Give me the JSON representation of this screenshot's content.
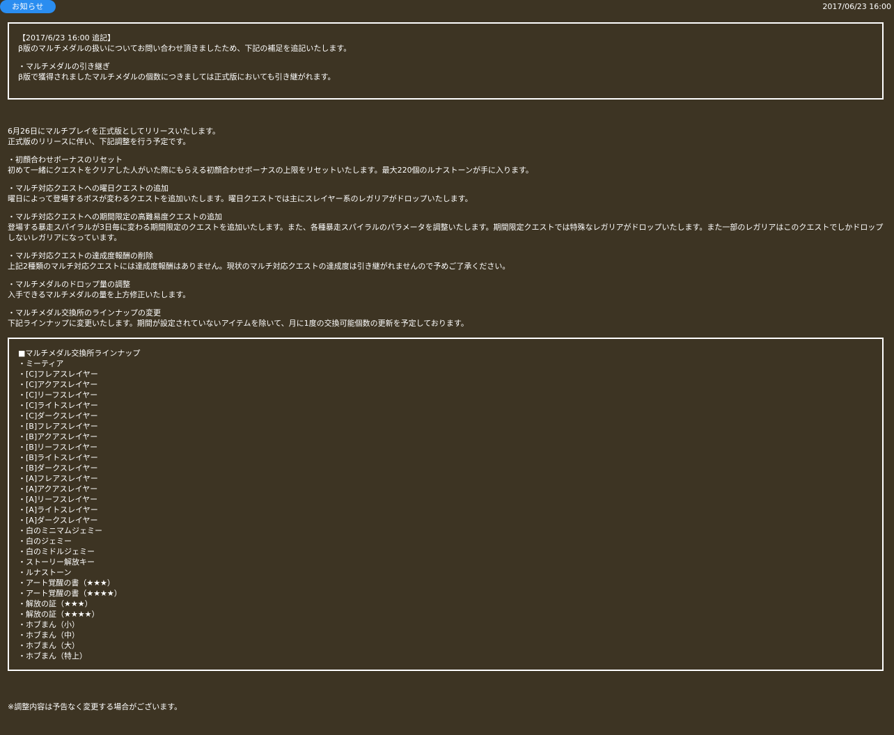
{
  "header": {
    "badge": "お知らせ",
    "date": "2017/06/23 16:00"
  },
  "addendum": {
    "title": "【2017/6/23 16:00 追記】",
    "line1": "β版のマルチメダルの扱いについてお問い合わせ頂きましたため、下記の補足を追記いたします。",
    "item_heading": "・マルチメダルの引き継ぎ",
    "item_body": "β版で獲得されましたマルチメダルの個数につきましては正式版においても引き継がれます。"
  },
  "intro": {
    "line1": "6月26日にマルチプレイを正式版としてリリースいたします。",
    "line2": "正式版のリリースに伴い、下記調整を行う予定です。"
  },
  "sections": [
    {
      "heading": "・初顔合わせボーナスのリセット",
      "body": "初めて一緒にクエストをクリアした人がいた際にもらえる初顔合わせボーナスの上限をリセットいたします。最大220個のルナストーンが手に入ります。"
    },
    {
      "heading": "・マルチ対応クエストへの曜日クエストの追加",
      "body": "曜日によって登場するボスが変わるクエストを追加いたします。曜日クエストでは主にスレイヤー系のレガリアがドロップいたします。"
    },
    {
      "heading": "・マルチ対応クエストへの期間限定の高難易度クエストの追加",
      "body": "登場する暴走スパイラルが3日毎に変わる期間限定のクエストを追加いたします。また、各種暴走スパイラルのパラメータを調整いたします。期間限定クエストでは特殊なレガリアがドロップいたします。また一部のレガリアはこのクエストでしかドロップしないレガリアになっています。"
    },
    {
      "heading": "・マルチ対応クエストの達成度報酬の削除",
      "body": "上記2種類のマルチ対応クエストには達成度報酬はありません。現状のマルチ対応クエストの達成度は引き継がれませんので予めご了承ください。"
    },
    {
      "heading": "・マルチメダルのドロップ量の調整",
      "body": "入手できるマルチメダルの量を上方修正いたします。"
    },
    {
      "heading": "・マルチメダル交換所のラインナップの変更",
      "body": "下記ラインナップに変更いたします。期間が設定されていないアイテムを除いて、月に1度の交換可能個数の更新を予定しております。"
    }
  ],
  "lineup": {
    "title": "■マルチメダル交換所ラインナップ",
    "items": [
      "・ミーティア",
      "・[C]フレアスレイヤー",
      "・[C]アクアスレイヤー",
      "・[C]リーフスレイヤー",
      "・[C]ライトスレイヤー",
      "・[C]ダークスレイヤー",
      "・[B]フレアスレイヤー",
      "・[B]アクアスレイヤー",
      "・[B]リーフスレイヤー",
      "・[B]ライトスレイヤー",
      "・[B]ダークスレイヤー",
      "・[A]フレアスレイヤー",
      "・[A]アクアスレイヤー",
      "・[A]リーフスレイヤー",
      "・[A]ライトスレイヤー",
      "・[A]ダークスレイヤー",
      "・白のミニマムジェミー",
      "・白のジェミー",
      "・白のミドルジェミー",
      "・ストーリー解放キー",
      "・ルナストーン",
      "・アート覚醒の書（★★★）",
      "・アート覚醒の書（★★★★）",
      "・解放の証（★★★）",
      "・解放の証（★★★★）",
      "・ホブまん（小）",
      "・ホブまん（中）",
      "・ホブまん（大）",
      "・ホブまん（特上）"
    ]
  },
  "footer_note": "※調整内容は予告なく変更する場合がございます。"
}
